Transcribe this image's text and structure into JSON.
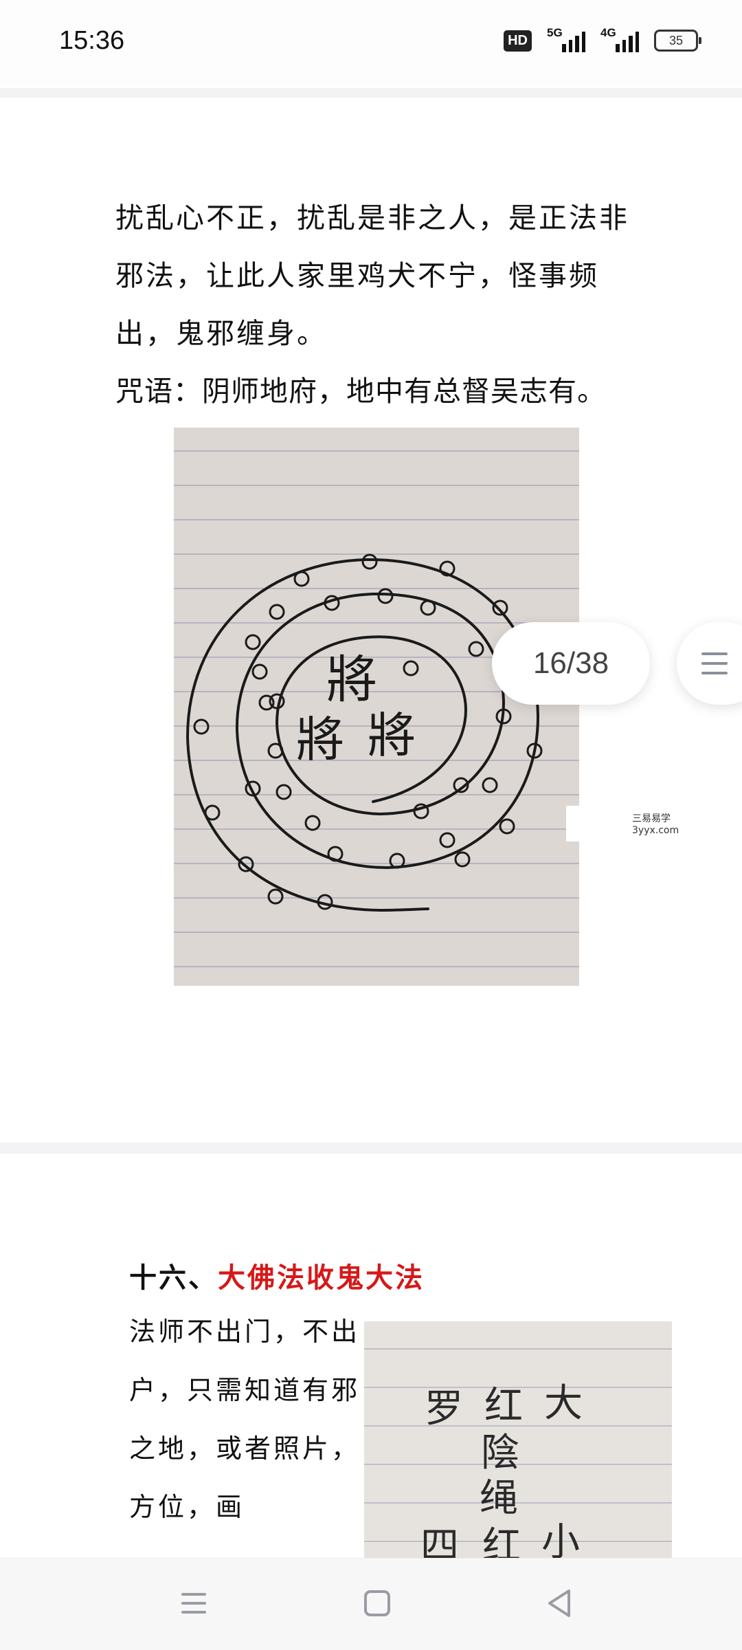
{
  "status_bar": {
    "time": "15:36",
    "hd_label": "HD",
    "net1": "5G",
    "net2": "4G",
    "battery": "35"
  },
  "article": {
    "paragraph1": "扰乱心不正，扰乱是非之人，是正法非邪法，让此人家里鸡犬不宁，怪事频出，鬼邪缠身。",
    "mantra": "咒语：阴师地府，地中有总督吴志有。",
    "image1": {
      "chars": [
        "將",
        "將",
        "將"
      ]
    },
    "section16": {
      "number": "十六、",
      "title": "大佛法收鬼大法",
      "body": "法师不出门，不出户，只需知道有邪之地，或者照片，方位，画",
      "image2_chars": [
        "罗",
        "红",
        "大",
        "陰",
        "绳",
        "四",
        "红",
        "小"
      ]
    }
  },
  "reader": {
    "page_indicator": "16/38",
    "menu_icon": "menu-icon"
  },
  "watermark": {
    "name": "三易易学",
    "url": "3yyx.com"
  },
  "nav_bar": {
    "menu": "menu-icon",
    "home": "square-icon",
    "back": "back-triangle-icon"
  }
}
